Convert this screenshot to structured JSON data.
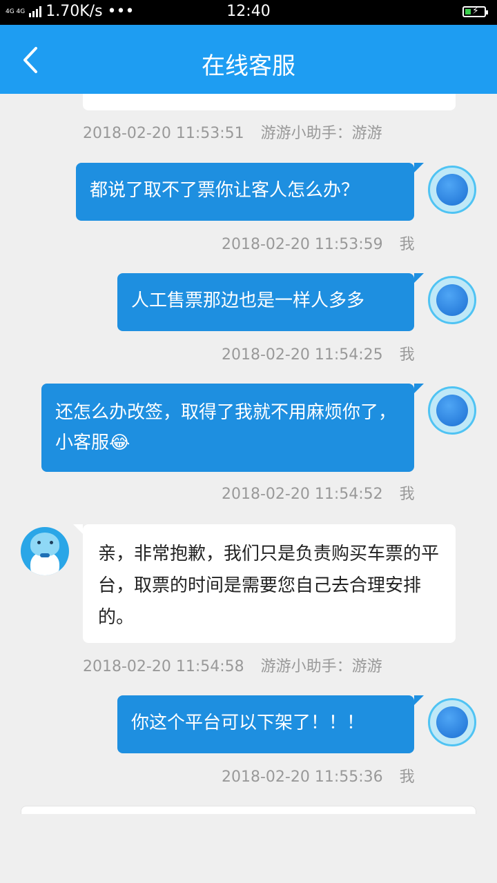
{
  "status_bar": {
    "network": "4G 4G",
    "speed": "1.70K/s •••",
    "time": "12:40",
    "battery_icon": "battery-charging-icon"
  },
  "header": {
    "title": "在线客服",
    "back_icon": "chevron-left-icon",
    "bg_color": "#1e9df2"
  },
  "messages": [
    {
      "side": "left",
      "text": "",
      "time": "2018-02-20 11:53:51",
      "sender": "游游小助手：游游"
    },
    {
      "side": "right",
      "text": "都说了取不了票你让客人怎么办？",
      "time": "2018-02-20 11:53:59",
      "sender": "我"
    },
    {
      "side": "right",
      "text": "人工售票那边也是一样人多多",
      "time": "2018-02-20 11:54:25",
      "sender": "我"
    },
    {
      "side": "right",
      "text": "还怎么办改签，取得了我就不用麻烦你了，小客服😂",
      "time": "2018-02-20 11:54:52",
      "sender": "我"
    },
    {
      "side": "left",
      "text": "亲，非常抱歉，我们只是负责购买车票的平台，取票的时间是需要您自己去合理安排的。",
      "time": "2018-02-20 11:54:58",
      "sender": "游游小助手：游游"
    },
    {
      "side": "right",
      "text": "你这个平台可以下架了！！！",
      "time": "2018-02-20 11:55:36",
      "sender": "我"
    }
  ],
  "colors": {
    "user_bubble": "#1e8fe0",
    "bot_bubble": "#ffffff",
    "background": "#efefef"
  }
}
